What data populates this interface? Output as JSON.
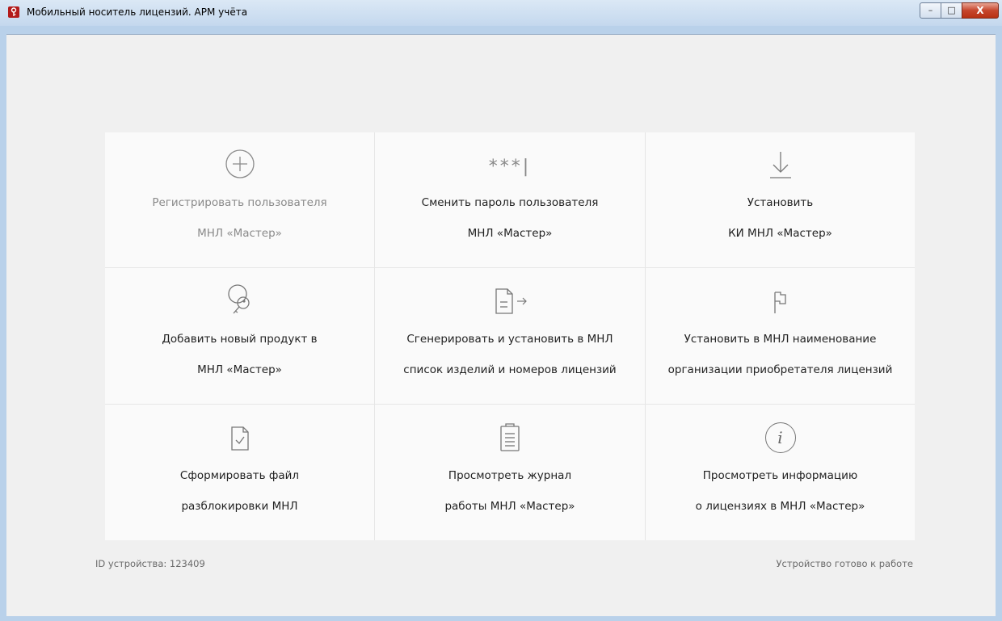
{
  "window": {
    "title": "Мобильный носитель лицензий. АРМ учёта",
    "controls": {
      "minimize": "–",
      "maximize": "□",
      "close": "X"
    }
  },
  "tiles": [
    {
      "icon": "plus-circle-icon",
      "line1": "Регистрировать пользователя",
      "line2": "МНЛ «Мастер»",
      "enabled": false
    },
    {
      "icon": "password-icon",
      "icon_text": "***|",
      "line1": "Сменить пароль пользователя",
      "line2": "МНЛ «Мастер»",
      "enabled": true
    },
    {
      "icon": "download-icon",
      "line1": "Установить",
      "line2": "КИ МНЛ «Мастер»",
      "enabled": true
    },
    {
      "icon": "keys-icon",
      "line1": "Добавить новый продукт в",
      "line2": "МНЛ «Мастер»",
      "enabled": true
    },
    {
      "icon": "document-arrow-icon",
      "line1": "Сгенерировать и установить в МНЛ",
      "line2": "список изделий и номеров лицензий",
      "enabled": true
    },
    {
      "icon": "flag-icon",
      "line1": "Установить в МНЛ наименование",
      "line2": "организации приобретателя лицензий",
      "enabled": true
    },
    {
      "icon": "document-check-icon",
      "line1": "Сформировать файл",
      "line2": "разблокировки МНЛ",
      "enabled": true
    },
    {
      "icon": "clipboard-icon",
      "line1": "Просмотреть журнал",
      "line2": "работы МНЛ «Мастер»",
      "enabled": true
    },
    {
      "icon": "info-icon",
      "icon_text": "i",
      "line1": "Просмотреть информацию",
      "line2": "о лицензиях в МНЛ «Мастер»",
      "enabled": true
    }
  ],
  "footer": {
    "device_id": "ID устройства: 123409",
    "status": "Устройство готово к работе"
  },
  "colors": {
    "accent": "#b31b1b",
    "tile_bg": "#fafafa",
    "grid_line": "#e6e6e6",
    "disabled_text": "#8a8a8a"
  }
}
